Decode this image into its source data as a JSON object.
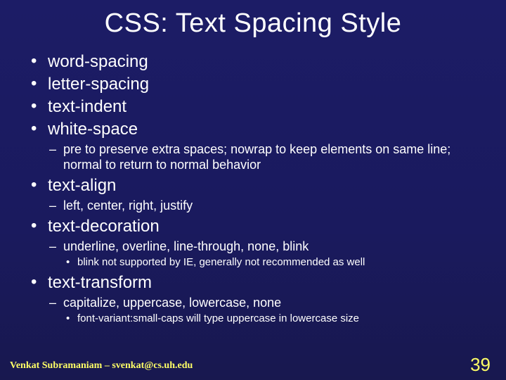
{
  "title": "CSS: Text Spacing Style",
  "bullets": {
    "i0": "word-spacing",
    "i1": "letter-spacing",
    "i2": "text-indent",
    "i3": "white-space",
    "i3_sub0": "pre to preserve extra spaces; nowrap to keep elements on same line; normal to return to normal behavior",
    "i4": "text-align",
    "i4_sub0": "left, center, right, justify",
    "i5": "text-decoration",
    "i5_sub0": "underline, overline, line-through, none, blink",
    "i5_sub0_sub0": "blink not supported by IE, generally not recommended as well",
    "i6": "text-transform",
    "i6_sub0": "capitalize, uppercase, lowercase, none",
    "i6_sub0_sub0": "font-variant:small-caps will type uppercase in lowercase size"
  },
  "footer": "Venkat Subramaniam – svenkat@cs.uh.edu",
  "page_number": "39"
}
